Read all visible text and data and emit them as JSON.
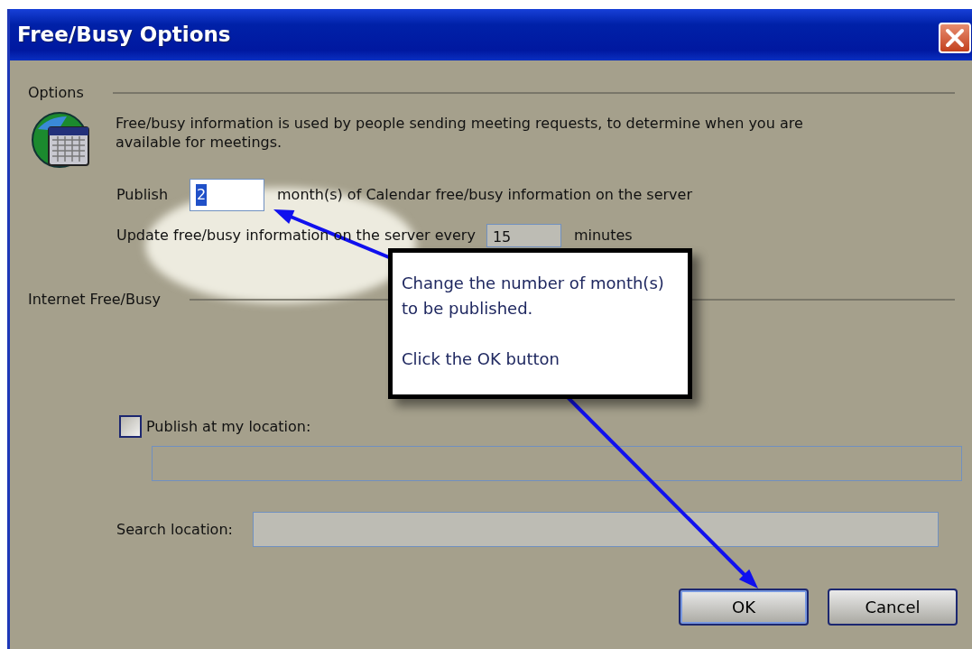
{
  "window": {
    "title": "Free/Busy Options"
  },
  "options": {
    "heading": "Options",
    "description": "Free/busy information is used by people sending meeting requests, to determine when you are available for meetings.",
    "publish": {
      "label": "Publish",
      "value": "2",
      "value_selected": true,
      "suffix": "month(s) of Calendar free/busy information on the server"
    },
    "update": {
      "label": "Update free/busy information on the server every",
      "value": "15",
      "disabled": true,
      "suffix": "minutes"
    }
  },
  "internet": {
    "heading": "Internet Free/Busy",
    "publish_location": {
      "label": "Publish at my location:",
      "checked": false,
      "disabled": true
    },
    "search_location": {
      "label": "Search location:",
      "disabled": true
    }
  },
  "buttons": [
    {
      "label": "OK",
      "default": true
    },
    {
      "label": "Cancel",
      "default": false
    }
  ],
  "callout": {
    "paragraphs": [
      "Change the number of month(s) to be published.",
      "Click the OK button"
    ]
  }
}
